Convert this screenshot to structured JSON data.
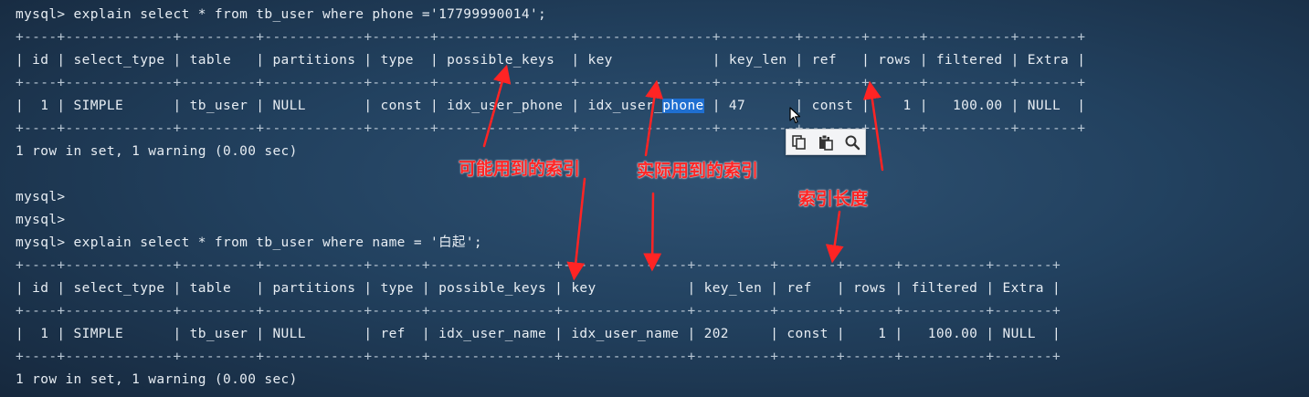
{
  "terminal": {
    "lines": [
      "mysql> explain select * from tb_user where phone ='17799990014';",
      "+----+-------------+---------+------------+-------+----------------+----------------+---------+-------+------+----------+-------+",
      "| id | select_type | table   | partitions | type  | possible_keys  | key            | key_len | ref   | rows | filtered | Extra |",
      "+----+-------------+---------+------------+-------+----------------+----------------+---------+-------+------+----------+-------+",
      "|  1 | SIMPLE      | tb_user | NULL       | const | idx_user_phone | idx_user_",
      "+----+-------------+---------+------------+-------+----------------+----------------+---------+-------+------+----------+-------+",
      "1 row in set, 1 warning (0.00 sec)",
      "",
      "mysql>",
      "mysql>",
      "mysql> explain select * from tb_user where name = '白起';",
      "+----+-------------+---------+------------+------+---------------+---------------+---------+-------+------+----------+-------+",
      "| id | select_type | table   | partitions | type | possible_keys | key           | key_len | ref   | rows | filtered | Extra |",
      "+----+-------------+---------+------------+------+---------------+---------------+---------+-------+------+----------+-------+",
      "|  1 | SIMPLE      | tb_user | NULL       | ref  | idx_user_name | idx_user_name | 202     | const |    1 |   100.00 | NULL  |",
      "+----+-------------+---------+------------+------+---------------+---------------+---------+-------+------+----------+-------+",
      "1 row in set, 1 warning (0.00 sec)"
    ],
    "selected_text": "phone",
    "row1_rest": " | 47      | const |    1 |   100.00 | NULL  |"
  },
  "annotations": {
    "possible_keys": "可能用到的索引",
    "key": "实际用到的索引",
    "key_len": "索引长度"
  },
  "toolbar": {
    "icons": [
      "copy-icon",
      "paste-icon",
      "search-icon"
    ]
  },
  "colors": {
    "annotation": "#ff2424",
    "selection": "#1f6fd1",
    "text": "#e7edf3"
  }
}
